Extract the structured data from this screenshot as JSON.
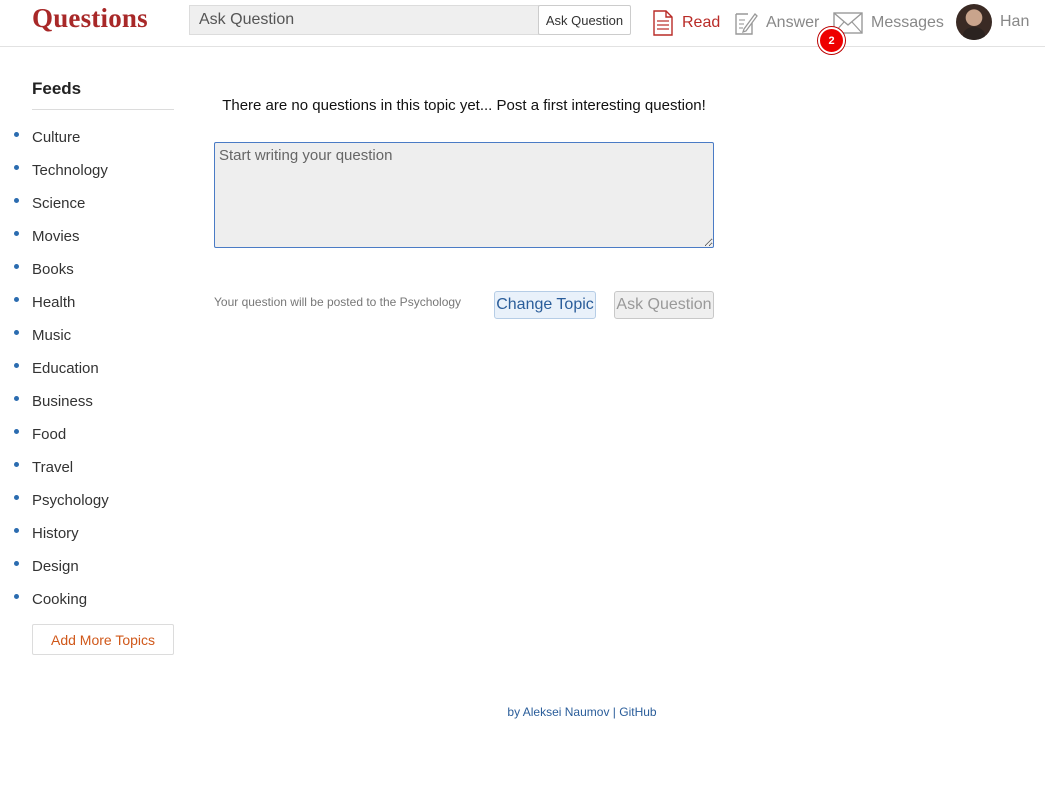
{
  "header": {
    "logo": "Questions",
    "search": {
      "placeholder": "Ask Question",
      "button_label": "Ask Question"
    },
    "nav": {
      "read": "Read",
      "answer": "Answer",
      "messages": "Messages",
      "messages_badge": "2",
      "profile_name": "Han"
    },
    "colors": {
      "brand": "#a82828",
      "active_nav": "#b92b27",
      "inactive_nav": "#888888",
      "badge": "#ee0000"
    }
  },
  "sidebar": {
    "title": "Feeds",
    "topics": [
      {
        "label": "Culture"
      },
      {
        "label": "Technology"
      },
      {
        "label": "Science"
      },
      {
        "label": "Movies"
      },
      {
        "label": "Books"
      },
      {
        "label": "Health"
      },
      {
        "label": "Music"
      },
      {
        "label": "Education"
      },
      {
        "label": "Business"
      },
      {
        "label": "Food"
      },
      {
        "label": "Travel"
      },
      {
        "label": "Psychology"
      },
      {
        "label": "History"
      },
      {
        "label": "Design"
      },
      {
        "label": "Cooking"
      }
    ],
    "add_more_label": "Add More Topics"
  },
  "main": {
    "empty_message": "There are no questions in this topic yet... Post a first interesting question!",
    "question_placeholder": "Start writing your question",
    "post_note": "Your question will be posted to the Psychology",
    "change_topic_label": "Change Topic",
    "ask_label": "Ask Question"
  },
  "footer": {
    "author": "by Aleksei Naumov",
    "separator": "|",
    "github": "GitHub"
  },
  "icons": {
    "read": "document-icon",
    "answer": "edit-icon",
    "messages": "envelope-icon"
  }
}
